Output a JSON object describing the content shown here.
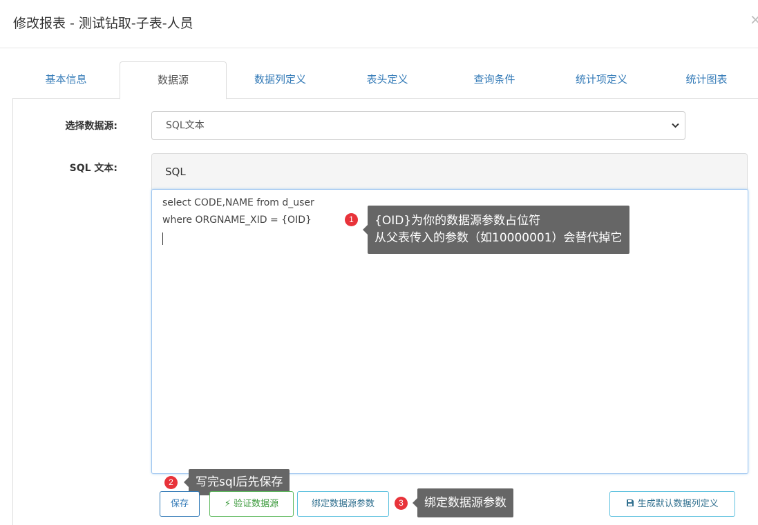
{
  "dialog": {
    "title": "修改报表 - 测试钻取-子表-人员",
    "close": "×"
  },
  "tabs": [
    {
      "label": "基本信息"
    },
    {
      "label": "数据源",
      "active": true
    },
    {
      "label": "数据列定义"
    },
    {
      "label": "表头定义"
    },
    {
      "label": "查询条件"
    },
    {
      "label": "统计项定义"
    },
    {
      "label": "统计图表"
    }
  ],
  "form": {
    "datasource_label": "选择数据源:",
    "datasource_value": "SQL文本",
    "sql_label": "SQL 文本:",
    "editor_title": "SQL",
    "sql_lines": [
      "select CODE,NAME from d_user",
      "where ORGNAME_XID = {OID}"
    ]
  },
  "callouts": [
    {
      "badge": "1",
      "lines": [
        "{OID}为你的数据源参数占位符",
        "从父表传入的参数（如10000001）会替代掉它"
      ]
    },
    {
      "badge": "2",
      "lines": [
        "写完sql后先保存"
      ]
    },
    {
      "badge": "3",
      "lines": [
        "绑定数据源参数"
      ]
    }
  ],
  "buttons": {
    "save": "保存",
    "validate": "验证数据源",
    "bind_params": "绑定数据源参数",
    "generate_columns": "生成默认数据列定义"
  },
  "icons": {
    "validate": "bolt-icon",
    "generate": "save-file-icon",
    "select": "chevron-down-icon"
  }
}
